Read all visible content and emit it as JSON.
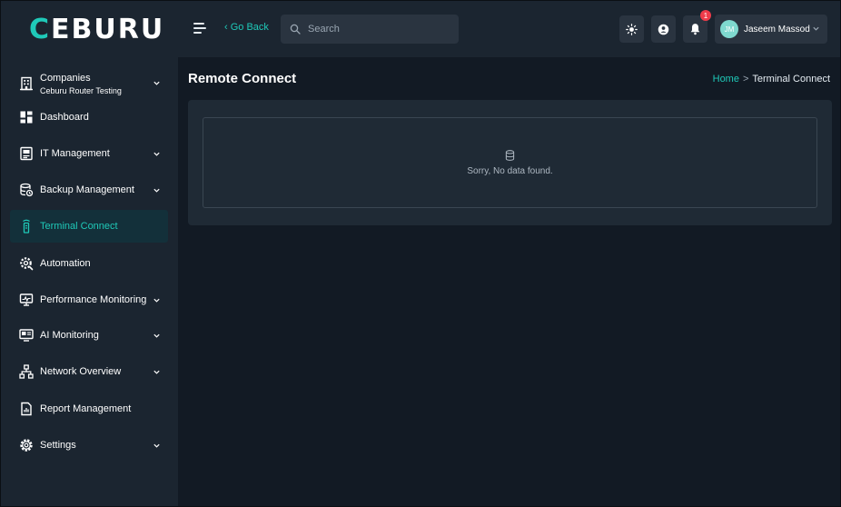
{
  "brand": {
    "logo_first": "C",
    "logo_rest": "EBURU",
    "accent": "#1fc9b8"
  },
  "header": {
    "go_back": "‹ Go Back",
    "search_placeholder": "Search",
    "notification_count": "1",
    "user": {
      "initials": "JM",
      "name": "Jaseem Massod"
    }
  },
  "sidebar": {
    "company": {
      "label": "Companies",
      "sub": "Ceburu Router Testing"
    },
    "items": [
      {
        "label": "Dashboard",
        "icon": "dashboard-icon",
        "chevron": false
      },
      {
        "label": "IT Management",
        "icon": "it-management-icon",
        "chevron": true
      },
      {
        "label": "Backup Management",
        "icon": "backup-icon",
        "chevron": true
      },
      {
        "label": "Terminal Connect",
        "icon": "terminal-icon",
        "chevron": false,
        "active": true
      },
      {
        "label": "Automation",
        "icon": "automation-icon",
        "chevron": false
      },
      {
        "label": "Performance Monitoring",
        "icon": "monitor-icon",
        "chevron": true
      },
      {
        "label": "AI Monitoring",
        "icon": "ai-monitoring-icon",
        "chevron": true
      },
      {
        "label": "Network Overview",
        "icon": "network-icon",
        "chevron": true
      },
      {
        "label": "Report Management",
        "icon": "report-icon",
        "chevron": false
      },
      {
        "label": "Settings",
        "icon": "settings-icon",
        "chevron": true
      }
    ]
  },
  "main": {
    "title": "Remote Connect",
    "breadcrumb": {
      "home": "Home",
      "separator": ">",
      "current": "Terminal Connect"
    },
    "empty_message": "Sorry, No data found."
  },
  "colors": {
    "background": "#121a24",
    "panel": "#1b2530",
    "card": "#1f2a35",
    "badge": "#ef3b4a"
  }
}
